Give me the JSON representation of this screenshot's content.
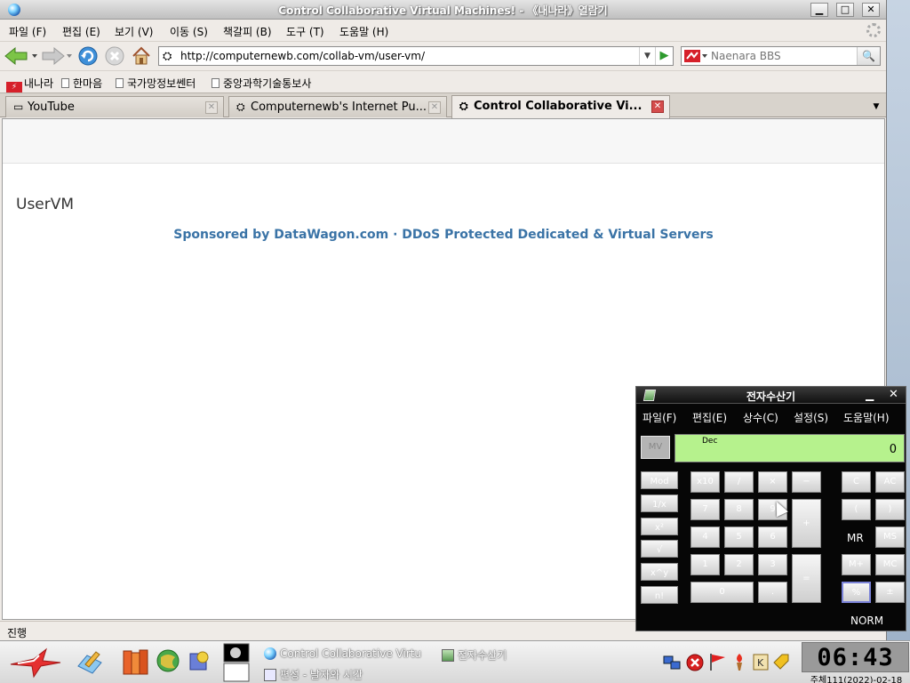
{
  "window": {
    "title": "Control Collaborative Virtual Machines! - 《내나라》열람기",
    "btn_min": "▁",
    "btn_max": "□",
    "btn_close": "✕"
  },
  "menu": {
    "file": "파일 (F)",
    "edit": "편집 (E)",
    "view": "보기 (V)",
    "go": "이동 (S)",
    "bookmarks": "책갈피 (B)",
    "tools": "도구 (T)",
    "help": "도움말 (H)"
  },
  "nav": {
    "url": "http://computernewb.com/collab-vm/user-vm/",
    "search_placeholder": "Naenara BBS"
  },
  "bookmarks": [
    "내나라",
    "한마음",
    "국가망정보쎈터",
    "중앙과학기술통보사"
  ],
  "tabs": [
    {
      "label": "YouTube"
    },
    {
      "label": "Computernewb's Internet Pu..."
    },
    {
      "label": "Control Collaborative Vi..."
    }
  ],
  "page": {
    "heading": "UserVM",
    "sponsor": "Sponsored by DataWagon.com · DDoS Protected Dedicated & Virtual Servers"
  },
  "status": {
    "text": "진행"
  },
  "calculator": {
    "title": "전자수산기",
    "menu": [
      "파일(F)",
      "편집(E)",
      "상수(C)",
      "설정(S)",
      "도움말(H)"
    ],
    "mode": "Dec",
    "display": "0",
    "mv_label": "MV",
    "keys_left": [
      "Mod",
      "1/x",
      "x²",
      "√",
      "x^y",
      "n!"
    ],
    "keys_mid": [
      "x10",
      "/",
      "×",
      "−",
      "7",
      "8",
      "9",
      "+",
      "4",
      "5",
      "6",
      "1",
      "2",
      "3",
      "=",
      "0",
      "."
    ],
    "keys_right": [
      "C",
      "AC",
      "(",
      ")",
      "MS",
      "M+",
      "MC",
      "%",
      "±"
    ],
    "mr_label": "MR",
    "norm_label": "NORM"
  },
  "taskbar": {
    "tasks": [
      {
        "label": "Control Collaborative Virtu"
      },
      {
        "label": "전자수산기"
      },
      {
        "label": "편성 - 날자와 시간"
      }
    ],
    "clock": "06:43",
    "date": "주체111(2022)-02-18"
  },
  "colors": {
    "sponsor": "#3a73a6",
    "calc_display": "#b6f28d",
    "tab_close_active": "#d44c4c"
  }
}
